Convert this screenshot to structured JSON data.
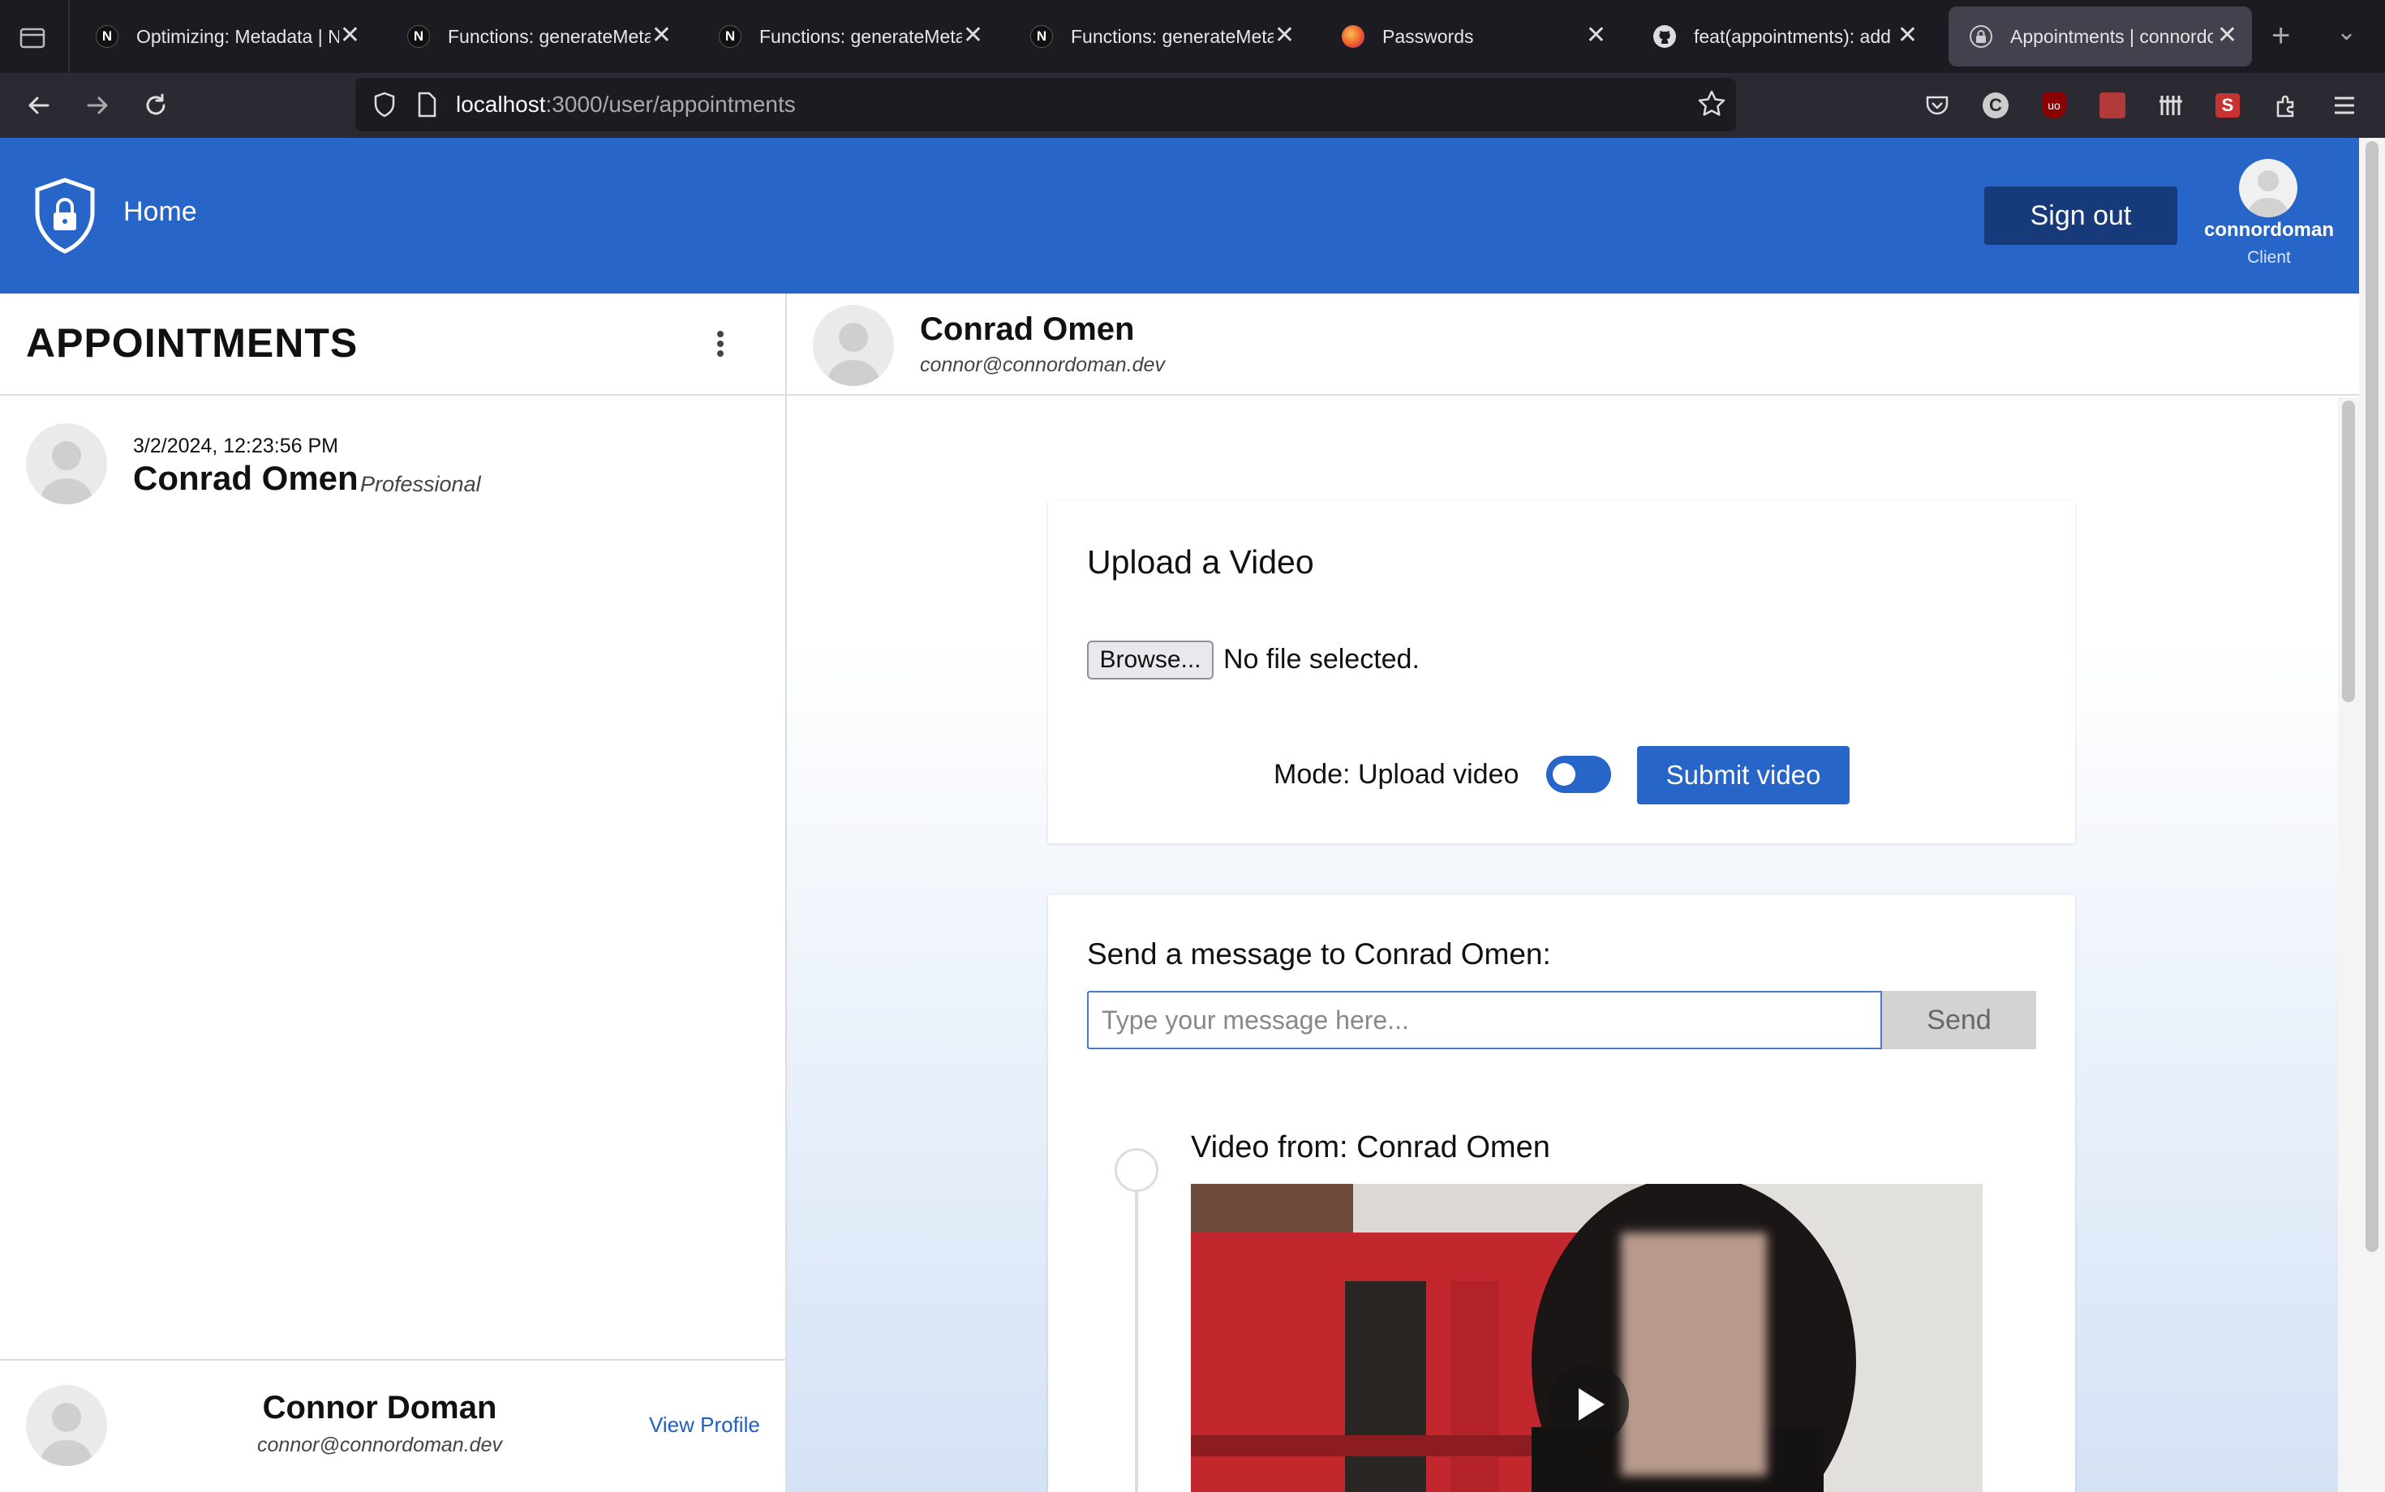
{
  "browser": {
    "tabs": [
      {
        "title": "Optimizing: Metadata | Next.js",
        "favicon": "N"
      },
      {
        "title": "Functions: generateMetadata",
        "favicon": "N"
      },
      {
        "title": "Functions: generateMetadata",
        "favicon": "N"
      },
      {
        "title": "Functions: generateMetadata",
        "favicon": "N"
      },
      {
        "title": "Passwords",
        "favicon": "firefox"
      },
      {
        "title": "feat(appointments): add a",
        "favicon": "github"
      },
      {
        "title": "Appointments | connordoman",
        "favicon": "lock",
        "active": true
      }
    ],
    "url_host": "localhost",
    "url_path": ":3000/user/appointments"
  },
  "header": {
    "home_label": "Home",
    "signout_label": "Sign out",
    "username": "connordoman",
    "role": "Client"
  },
  "sidebar": {
    "title": "APPOINTMENTS",
    "appointments": [
      {
        "date": "3/2/2024, 12:23:56 PM",
        "name": "Conrad Omen",
        "role": "Professional"
      }
    ],
    "footer": {
      "name": "Connor Doman",
      "email": "connor@connordoman.dev",
      "view_profile": "View Profile"
    }
  },
  "main": {
    "contact": {
      "name": "Conrad Omen",
      "email": "connor@connordoman.dev"
    },
    "upload": {
      "title": "Upload a Video",
      "browse_label": "Browse...",
      "no_file": "No file selected.",
      "mode_label": "Mode: Upload video",
      "toggle_on": true,
      "submit_label": "Submit video"
    },
    "message": {
      "label": "Send a message to Conrad Omen:",
      "placeholder": "Type your message here...",
      "value": "",
      "send_label": "Send"
    },
    "timeline": [
      {
        "title": "Video from: Conrad Omen"
      }
    ]
  },
  "colors": {
    "brand": "#2765c8",
    "brand_dark": "#163a7a",
    "chrome_dark": "#1c1b22"
  }
}
